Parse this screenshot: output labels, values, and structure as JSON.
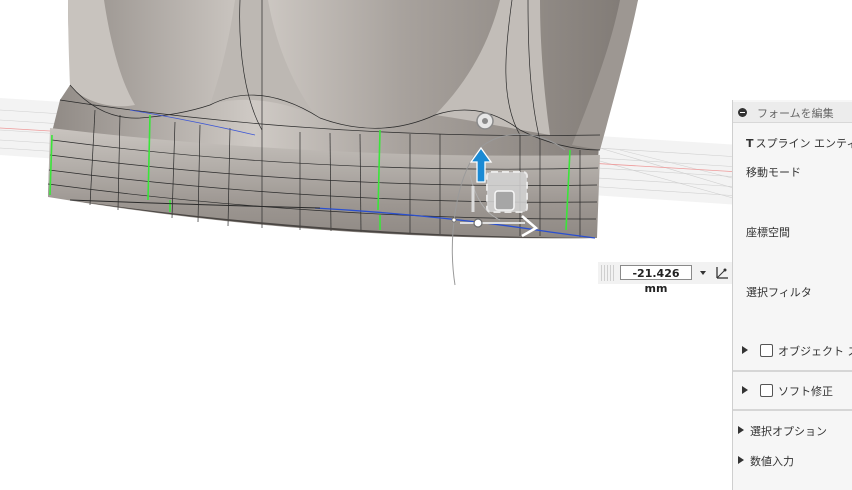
{
  "dimension": {
    "value": "-21.426 mm"
  },
  "panel": {
    "title": "フォームを編集",
    "spline_prefix": "T",
    "spline_label": "スプライン エンティ",
    "move_mode": "移動モード",
    "coord_space": "座標空間",
    "select_filter": "選択フィルタ",
    "object_label": "オブジェクト ス",
    "soft_mod": "ソフト修正",
    "select_options": "選択オプション",
    "numeric_input": "数値入力"
  },
  "colors": {
    "model": "#a7a19c",
    "edge_highlight": "#39e639",
    "manipulator_blue": "#1a8ad4",
    "panel_bg": "#f6f6f6"
  },
  "icons": [
    "collapse-icon",
    "triangle-right-icon",
    "checkbox-icon",
    "dropdown-arrow-icon",
    "axis-icon"
  ]
}
